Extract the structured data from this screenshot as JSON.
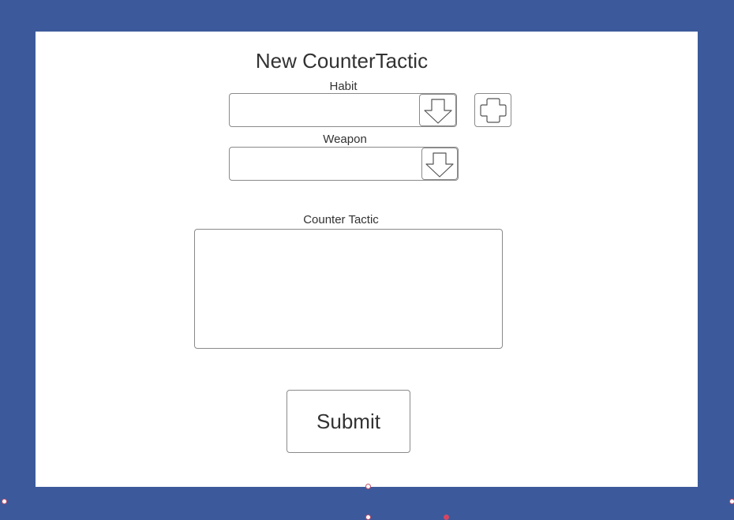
{
  "form": {
    "title": "New CounterTactic",
    "habit": {
      "label": "Habit",
      "value": ""
    },
    "weapon": {
      "label": "Weapon",
      "value": ""
    },
    "counter_tactic": {
      "label": "Counter Tactic",
      "value": ""
    },
    "submit_label": "Submit"
  },
  "icons": {
    "habit_dropdown": "arrow-down-icon",
    "weapon_dropdown": "arrow-down-icon",
    "add_habit": "plus-icon"
  },
  "colors": {
    "background": "#3c5a9b",
    "panel": "#ffffff",
    "border": "#8a8a8a",
    "text": "#323232"
  }
}
